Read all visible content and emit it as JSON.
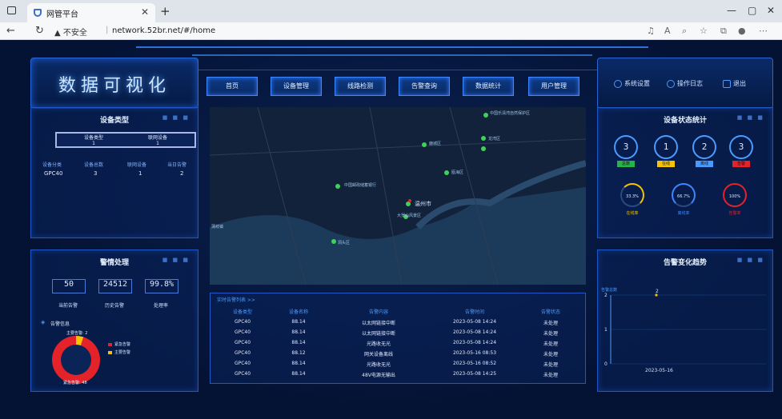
{
  "browser": {
    "tab_title": "网管平台",
    "security": "不安全",
    "url": "network.52br.net/#/home"
  },
  "dashboard": {
    "title": "数据可视化",
    "menu": [
      "首页",
      "设备管理",
      "线路检测",
      "告警查询",
      "数据统计",
      "用户管理"
    ],
    "right_actions": [
      "系统设置",
      "操作日志",
      "退出"
    ],
    "device_type": {
      "title": "设备类型",
      "box_left_label": "设备类型",
      "box_left_value": "1",
      "box_right_label": "联网设备",
      "box_right_value": "1",
      "headers": [
        "设备分类",
        "设备总数",
        "联网设备",
        "当日告警"
      ],
      "row": [
        "GPC40",
        "3",
        "1",
        "2"
      ]
    },
    "alarm_handle": {
      "title": "警情处理",
      "stats": [
        {
          "value": "50",
          "label": "当前告警"
        },
        {
          "value": "24512",
          "label": "历史告警"
        },
        {
          "value": "99.8%",
          "label": "处理率"
        }
      ],
      "info_label": "告警信息",
      "legend": [
        {
          "label": "紧急告警",
          "color": "#e3222a"
        },
        {
          "label": "主要告警",
          "color": "#f5c300"
        }
      ],
      "donut_labels": [
        "主要告警: 2",
        "紧急告警: 48"
      ]
    },
    "map": {
      "labels": [
        "中国邮政储蓄银行",
        "温州市",
        "鹿城区",
        "大罗山风景区",
        "瓯海区",
        "中国乐清湾自然保护区",
        "龙湾区",
        "洞头区",
        "蒲岐镇"
      ]
    },
    "alarm_table": {
      "caption": "实时告警列表 >>",
      "headers": [
        "设备类型",
        "设备名称",
        "告警内容",
        "告警时间",
        "告警状态"
      ],
      "rows": [
        [
          "GPC40",
          "88.14",
          "以太网链接中断",
          "2023-05-08 14:24",
          "未处理"
        ],
        [
          "GPC40",
          "88.14",
          "以太网链接中断",
          "2023-05-08 14:24",
          "未处理"
        ],
        [
          "GPC40",
          "88.14",
          "光路收无光",
          "2023-05-08 14:24",
          "未处理"
        ],
        [
          "GPC40",
          "88.12",
          "网关设备离线",
          "2023-05-16 08:53",
          "未处理"
        ],
        [
          "GPC40",
          "88.14",
          "光路收无光",
          "2023-05-16 08:52",
          "未处理"
        ],
        [
          "GPC40",
          "88.14",
          "48V电源无输出",
          "2023-05-08 14:25",
          "未处理"
        ]
      ]
    },
    "device_status": {
      "title": "设备状态统计",
      "counts": [
        {
          "value": "3",
          "label": "总数",
          "color": "#27b24a"
        },
        {
          "value": "1",
          "label": "在线",
          "color": "#f5c300"
        },
        {
          "value": "2",
          "label": "离线",
          "color": "#4a9bff"
        },
        {
          "value": "3",
          "label": "告警",
          "color": "#e3222a"
        }
      ],
      "rates": [
        {
          "value": "33.3%",
          "label": "在线率",
          "color": "#f5c300"
        },
        {
          "value": "66.7%",
          "label": "离线率",
          "color": "#3c86ff"
        },
        {
          "value": "100%",
          "label": "告警率",
          "color": "#e3222a"
        }
      ]
    },
    "trend": {
      "title": "告警变化趋势",
      "series_label": "告警总数",
      "point_label": "2",
      "x_label": "2023-05-16"
    }
  },
  "chart_data": {
    "type": "line",
    "title": "告警变化趋势",
    "x": [
      "2023-05-16"
    ],
    "series": [
      {
        "name": "告警总数",
        "values": [
          2
        ]
      }
    ],
    "ylim": [
      0,
      2
    ]
  }
}
